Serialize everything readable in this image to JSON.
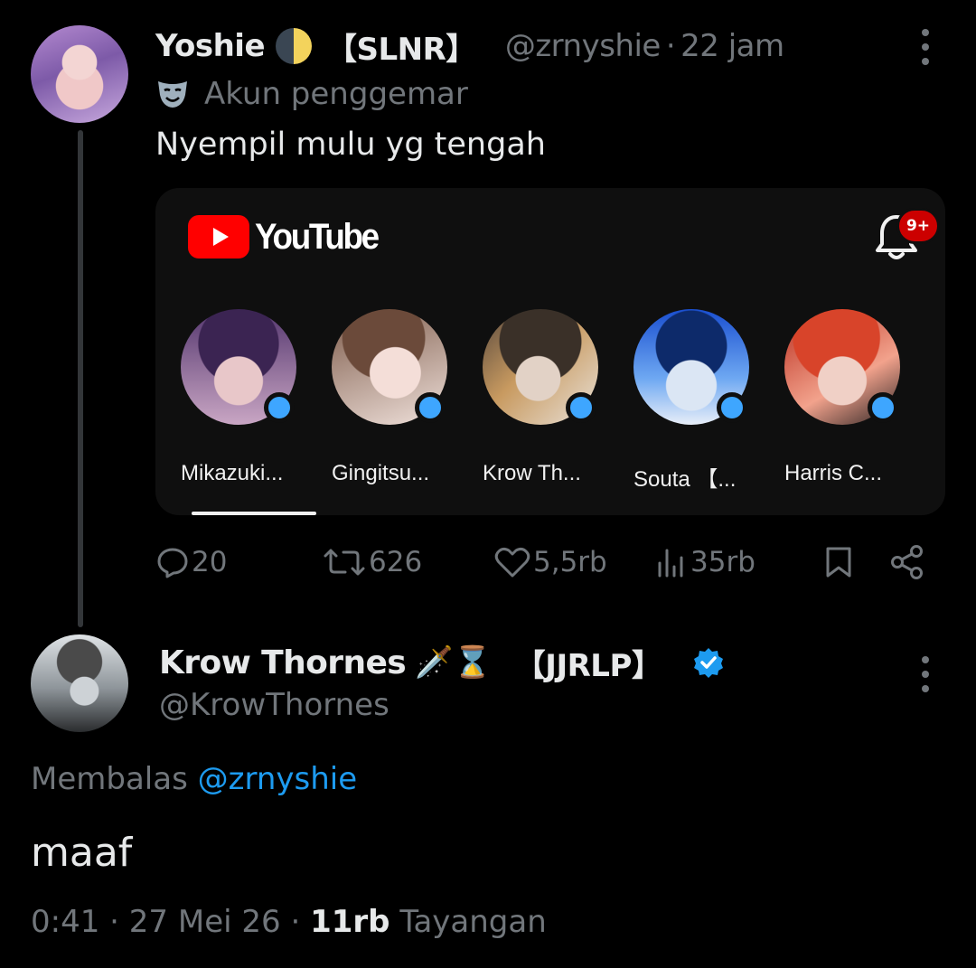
{
  "colors": {
    "background": "#000000",
    "text_primary": "#e7e9ea",
    "text_secondary": "#71767b",
    "accent_blue": "#1d9bf0",
    "youtube_red": "#ff0000",
    "youtube_verified_blue": "#3ea6ff"
  },
  "tweet1": {
    "avatar": "yoshie-avatar",
    "display_name": "Yoshie",
    "name_emoji_icon": "moon-icon",
    "name_tag": "【SLNR】",
    "handle": "@zrnyshie",
    "separator": "·",
    "time": "22 jam",
    "fan_icon": "theater-mask-icon",
    "fan_label": "Akun penggemar",
    "text": "Nyempil mulu yg tengah",
    "embed": {
      "brand": "YouTube",
      "brand_icon": "youtube-logo-icon",
      "bell_icon": "bell-icon",
      "notification_badge": "9+",
      "channels": [
        {
          "name": "Mikazuki...",
          "avatar": "mikazuki-avatar",
          "live_dot": true
        },
        {
          "name": "Gingitsu...",
          "avatar": "gingitsu-avatar",
          "live_dot": true
        },
        {
          "name": "Krow Th...",
          "avatar": "krow-avatar",
          "live_dot": true
        },
        {
          "name": "Souta 【...",
          "avatar": "souta-avatar",
          "live_dot": true
        },
        {
          "name": "Harris C...",
          "avatar": "harris-avatar",
          "live_dot": true
        }
      ]
    },
    "actions": {
      "replies": "20",
      "reposts": "626",
      "likes": "5,5rb",
      "views": "35rb"
    }
  },
  "tweet2": {
    "avatar": "krow-thornes-avatar",
    "display_name": "Krow Thornes",
    "name_emojis": "🗡️⌛",
    "name_tag": "【JJRLP】",
    "verified": true,
    "handle": "@KrowThornes",
    "replying_prefix": "Membalas",
    "replying_to": "@zrnyshie",
    "text": "maaf",
    "time": "0:41",
    "date": "27 Mei 26",
    "separator": "·",
    "views_count": "11rb",
    "views_label": "Tayangan"
  }
}
